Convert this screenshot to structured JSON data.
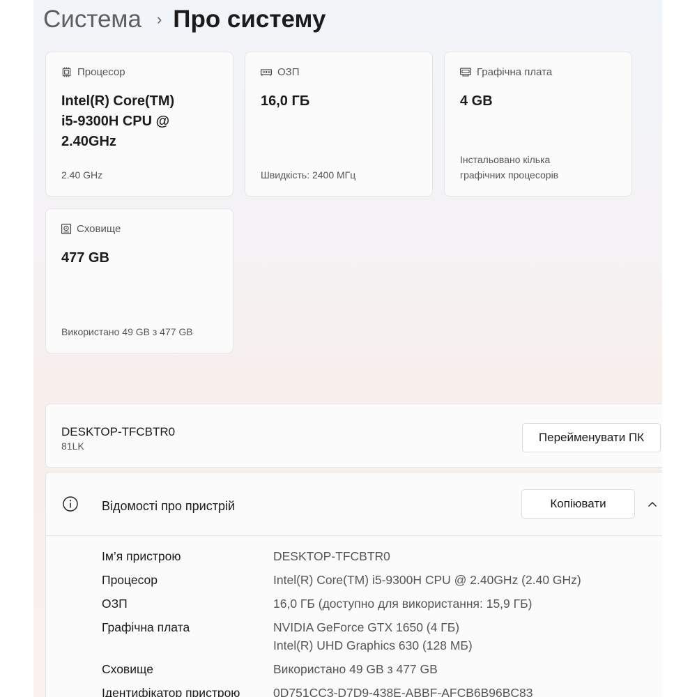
{
  "breadcrumb": {
    "parent": "Система",
    "separator": "›",
    "current": "Про систему"
  },
  "cards": {
    "processor": {
      "label": "Процесор",
      "value_line1": "Intel(R) Core(TM)",
      "value_line2": "i5-9300H CPU @",
      "value_line3": "2.40GHz",
      "sub": "2.40 GHz"
    },
    "ram": {
      "label": "ОЗП",
      "value": "16,0 ГБ",
      "sub": "Швидкість: 2400 МГц"
    },
    "graphics": {
      "label": "Графічна плата",
      "value": "4 GB",
      "sub_line1": "Інстальовано кілька",
      "sub_line2": "графічних процесорів"
    },
    "storage": {
      "label": "Сховище",
      "value": "477 GB",
      "sub": "Використано 49 GB з 477 GB"
    }
  },
  "device": {
    "name": "DESKTOP-TFCBTR0",
    "model": "81LK",
    "rename_label": "Перейменувати ПК"
  },
  "device_info": {
    "title": "Відомості про пристрій",
    "copy_label": "Копіювати",
    "rows": [
      {
        "label": "Ім’я пристрою",
        "value": "DESKTOP-TFCBTR0"
      },
      {
        "label": "Процесор",
        "value": "Intel(R) Core(TM) i5-9300H CPU @ 2.40GHz (2.40 GHz)"
      },
      {
        "label": "ОЗП",
        "value": "16,0 ГБ (доступно для використання: 15,9 ГБ)"
      },
      {
        "label": "Графічна плата",
        "value": "NVIDIA GeForce GTX 1650 (4 ГБ)",
        "value2": "Intel(R) UHD Graphics 630 (128 МБ)"
      },
      {
        "label": "Сховище",
        "value": "Використано 49 GB з 477 GB"
      },
      {
        "label": "Ідентифікатор пристрою",
        "value": "0D751CC3-D7D9-438E-ABBF-AFCB6B96BC83"
      }
    ]
  },
  "icons": {
    "processor": "cpu-chip-icon",
    "ram": "memory-module-icon",
    "graphics": "graphics-card-icon",
    "storage": "hard-drive-icon",
    "info": "info-circle-icon",
    "collapse": "chevron-up-icon"
  }
}
